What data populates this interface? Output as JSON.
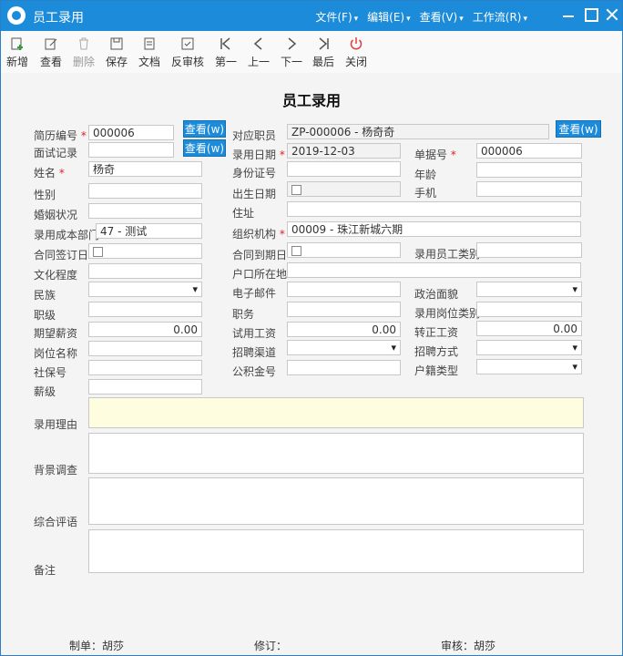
{
  "window": {
    "title": "员工录用"
  },
  "menu": [
    "文件(F)",
    "编辑(E)",
    "查看(V)",
    "工作流(R)"
  ],
  "toolbar": {
    "new": "新增",
    "view": "查看",
    "delete": "删除",
    "save": "保存",
    "doc": "文档",
    "unapprove": "反审核",
    "first": "第一",
    "prev": "上一",
    "next": "下一",
    "last": "最后",
    "close": "关闭"
  },
  "form": {
    "heading": "员工录用",
    "view_button": "查看(w)",
    "labels": {
      "resume_no": "简历编号",
      "interview": "面试记录",
      "name": "姓名",
      "gender": "性别",
      "marital": "婚姻状况",
      "cost_dept": "录用成本部门",
      "contract_sign": "合同签订日",
      "education": "文化程度",
      "ethnicity": "民族",
      "rank": "职级",
      "expected_salary": "期望薪资",
      "position_name": "岗位名称",
      "social_no": "社保号",
      "salary_grade": "薪级",
      "employee": "对应职员",
      "hire_date": "录用日期",
      "id_no": "身份证号",
      "birth_date": "出生日期",
      "address": "住址",
      "org": "组织机构",
      "contract_end": "合同到期日",
      "hukou_place": "户口所在地",
      "email": "电子邮件",
      "duty": "职务",
      "trial_salary": "试用工资",
      "channel": "招聘渠道",
      "fund_no": "公积金号",
      "doc_no": "单据号",
      "age": "年龄",
      "mobile": "手机",
      "emp_category": "录用员工类别",
      "political": "政治面貌",
      "post_category": "录用岗位类别",
      "regular_salary": "转正工资",
      "recruit_method": "招聘方式",
      "hukou_type": "户籍类型",
      "reason": "录用理由",
      "background": "背景调查",
      "evaluation": "综合评语",
      "remark": "备注"
    },
    "values": {
      "resume_no": "000006",
      "name": "杨奇",
      "cost_dept": "47 - 测试",
      "expected_salary": "0.00",
      "employee": "ZP-000006 - 杨奇奇",
      "hire_date": "2019-12-03",
      "org": "00009 - 珠江新城六期",
      "trial_salary": "0.00",
      "doc_no": "000006",
      "regular_salary": "0.00"
    }
  },
  "footer": {
    "creator": "制单：胡莎",
    "revise": "修订：",
    "auditor": "审核：胡莎"
  }
}
